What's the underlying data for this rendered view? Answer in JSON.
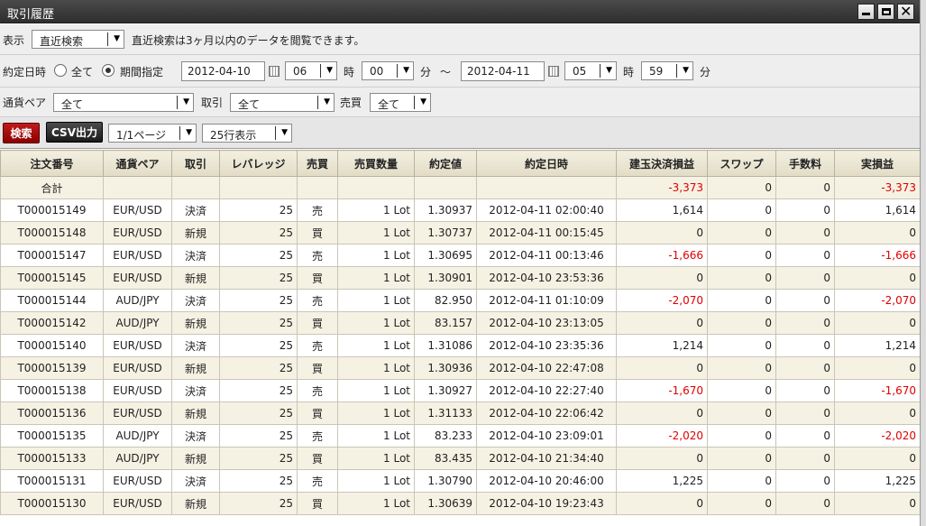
{
  "window": {
    "title": "取引履歴"
  },
  "filters": {
    "display_label": "表示",
    "display_value": "直近検索",
    "display_note": "直近検索は3ヶ月以内のデータを閲覧できます。",
    "exec_label": "約定日時",
    "radio_all": "全て",
    "radio_period": "期間指定",
    "from_date": "2012-04-10",
    "from_hour": "06",
    "from_min": "00",
    "hour_unit": "時",
    "min_unit": "分",
    "tilde": "～",
    "to_date": "2012-04-11",
    "to_hour": "05",
    "to_min": "59",
    "pair_label": "通貨ペア",
    "pair_value": "全て",
    "trade_label": "取引",
    "trade_value": "全て",
    "side_label": "売買",
    "side_value": "全て"
  },
  "toolbar": {
    "search_label": "検索",
    "csv_label": "CSV出力",
    "page_value": "1/1ページ",
    "rows_value": "25行表示"
  },
  "table": {
    "headers": [
      "注文番号",
      "通貨ペア",
      "取引",
      "レバレッジ",
      "売買",
      "売買数量",
      "約定値",
      "約定日時",
      "建玉決済損益",
      "スワップ",
      "手数料",
      "実損益"
    ],
    "total": {
      "label": "合計",
      "pl": "-3,373",
      "swap": "0",
      "fee": "0",
      "net": "-3,373"
    },
    "rows": [
      [
        "T000015149",
        "EUR/USD",
        "決済",
        "25",
        "売",
        "1 Lot",
        "1.30937",
        "2012-04-11 02:00:40",
        "1,614",
        "0",
        "0",
        "1,614"
      ],
      [
        "T000015148",
        "EUR/USD",
        "新規",
        "25",
        "買",
        "1 Lot",
        "1.30737",
        "2012-04-11 00:15:45",
        "0",
        "0",
        "0",
        "0"
      ],
      [
        "T000015147",
        "EUR/USD",
        "決済",
        "25",
        "売",
        "1 Lot",
        "1.30695",
        "2012-04-11 00:13:46",
        "-1,666",
        "0",
        "0",
        "-1,666"
      ],
      [
        "T000015145",
        "EUR/USD",
        "新規",
        "25",
        "買",
        "1 Lot",
        "1.30901",
        "2012-04-10 23:53:36",
        "0",
        "0",
        "0",
        "0"
      ],
      [
        "T000015144",
        "AUD/JPY",
        "決済",
        "25",
        "売",
        "1 Lot",
        "82.950",
        "2012-04-11 01:10:09",
        "-2,070",
        "0",
        "0",
        "-2,070"
      ],
      [
        "T000015142",
        "AUD/JPY",
        "新規",
        "25",
        "買",
        "1 Lot",
        "83.157",
        "2012-04-10 23:13:05",
        "0",
        "0",
        "0",
        "0"
      ],
      [
        "T000015140",
        "EUR/USD",
        "決済",
        "25",
        "売",
        "1 Lot",
        "1.31086",
        "2012-04-10 23:35:36",
        "1,214",
        "0",
        "0",
        "1,214"
      ],
      [
        "T000015139",
        "EUR/USD",
        "新規",
        "25",
        "買",
        "1 Lot",
        "1.30936",
        "2012-04-10 22:47:08",
        "0",
        "0",
        "0",
        "0"
      ],
      [
        "T000015138",
        "EUR/USD",
        "決済",
        "25",
        "売",
        "1 Lot",
        "1.30927",
        "2012-04-10 22:27:40",
        "-1,670",
        "0",
        "0",
        "-1,670"
      ],
      [
        "T000015136",
        "EUR/USD",
        "新規",
        "25",
        "買",
        "1 Lot",
        "1.31133",
        "2012-04-10 22:06:42",
        "0",
        "0",
        "0",
        "0"
      ],
      [
        "T000015135",
        "AUD/JPY",
        "決済",
        "25",
        "売",
        "1 Lot",
        "83.233",
        "2012-04-10 23:09:01",
        "-2,020",
        "0",
        "0",
        "-2,020"
      ],
      [
        "T000015133",
        "AUD/JPY",
        "新規",
        "25",
        "買",
        "1 Lot",
        "83.435",
        "2012-04-10 21:34:40",
        "0",
        "0",
        "0",
        "0"
      ],
      [
        "T000015131",
        "EUR/USD",
        "決済",
        "25",
        "売",
        "1 Lot",
        "1.30790",
        "2012-04-10 20:46:00",
        "1,225",
        "0",
        "0",
        "1,225"
      ],
      [
        "T000015130",
        "EUR/USD",
        "新規",
        "25",
        "買",
        "1 Lot",
        "1.30639",
        "2012-04-10 19:23:43",
        "0",
        "0",
        "0",
        "0"
      ]
    ]
  },
  "colors": {
    "negative": "#e00000",
    "header_bg": "#e9e4cf",
    "alt_row": "#f5f2e3"
  }
}
